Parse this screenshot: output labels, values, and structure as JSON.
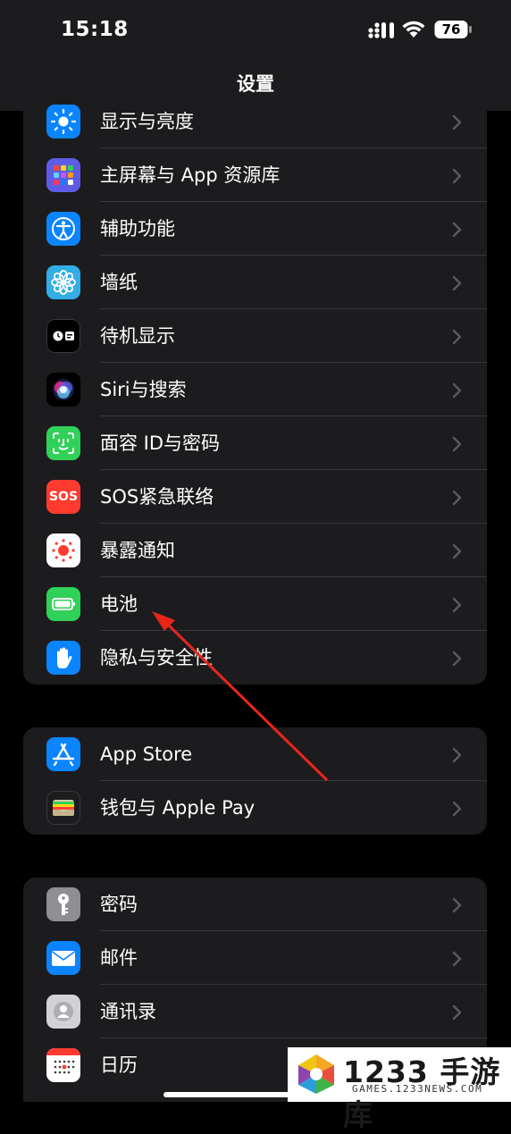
{
  "status_bar": {
    "time": "15:18",
    "battery_level": "76"
  },
  "nav": {
    "title": "设置"
  },
  "groups": [
    {
      "items": [
        {
          "label": "显示与亮度",
          "icon": "sun-icon",
          "color": "#0a84ff"
        },
        {
          "label": "主屏幕与 App 资源库",
          "icon": "home-screen-grid-icon",
          "color": "#5e5ce6"
        },
        {
          "label": "辅助功能",
          "icon": "accessibility-icon",
          "color": "#0a84ff"
        },
        {
          "label": "墙纸",
          "icon": "flower-icon",
          "color": "#32ade6"
        },
        {
          "label": "待机显示",
          "icon": "standby-icon",
          "color": "#1c1c1e"
        },
        {
          "label": "Siri与搜索",
          "icon": "siri-icon",
          "color": "#2c2c2e"
        },
        {
          "label": "面容 ID与密码",
          "icon": "face-id-icon",
          "color": "#30d158"
        },
        {
          "label": "SOS紧急联络",
          "icon": "sos-icon",
          "color": "#ff3b30",
          "icon_text": "SOS"
        },
        {
          "label": "暴露通知",
          "icon": "exposure-notification-icon",
          "color": "#ffffff"
        },
        {
          "label": "电池",
          "icon": "battery-icon",
          "color": "#30d158"
        },
        {
          "label": "隐私与安全性",
          "icon": "hand-icon",
          "color": "#0a84ff"
        }
      ]
    },
    {
      "items": [
        {
          "label": "App Store",
          "icon": "app-store-icon",
          "color": "#0a84ff"
        },
        {
          "label": "钱包与 Apple Pay",
          "icon": "wallet-icon",
          "color": "#1c1c1e"
        }
      ]
    },
    {
      "items": [
        {
          "label": "密码",
          "icon": "key-icon",
          "color": "#8e8e93"
        },
        {
          "label": "邮件",
          "icon": "mail-icon",
          "color": "#0a84ff"
        },
        {
          "label": "通讯录",
          "icon": "contacts-icon",
          "color": "#c7c7cc"
        },
        {
          "label": "日历",
          "icon": "calendar-icon",
          "color": "#ffffff"
        }
      ]
    }
  ],
  "watermark": {
    "brand": "1233 手游库",
    "url": "GAMES.1233NEWS.COM"
  }
}
